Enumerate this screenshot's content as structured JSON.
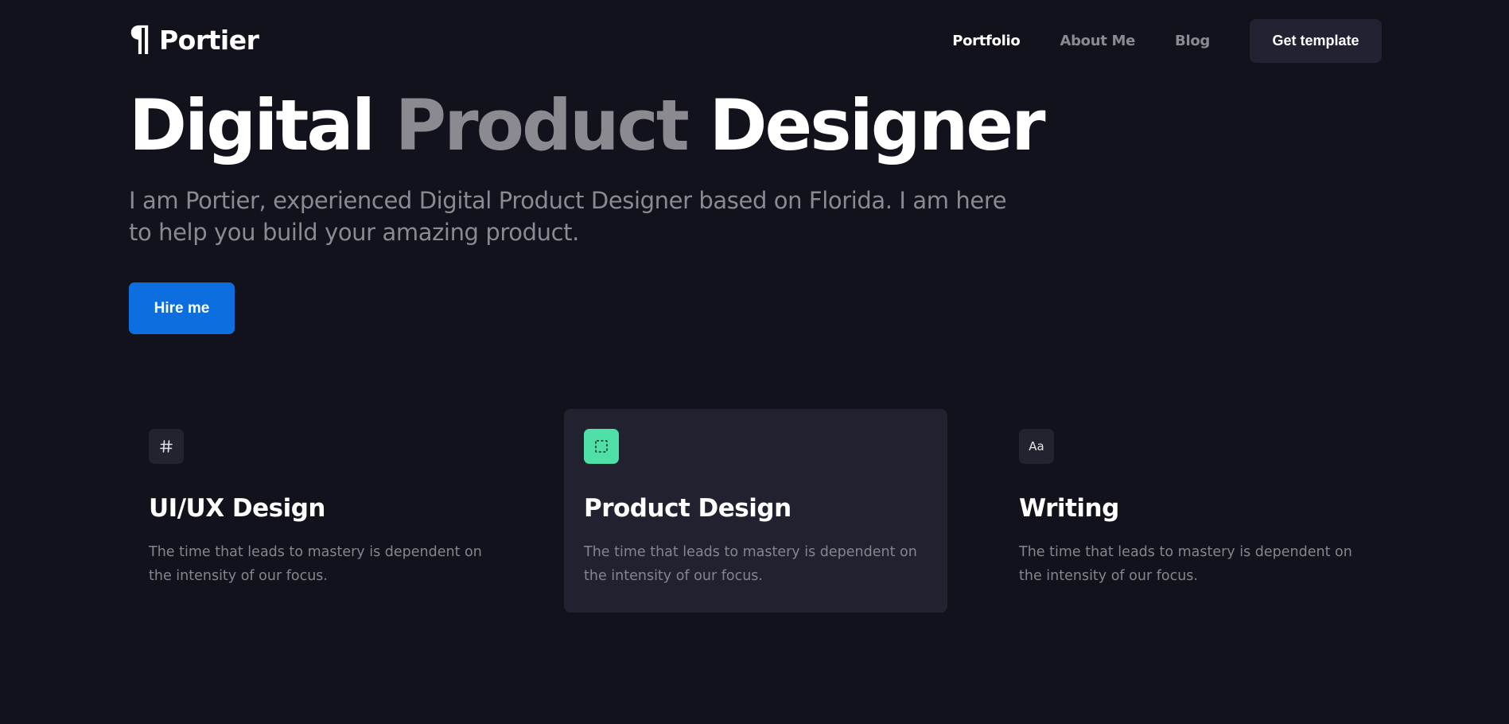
{
  "header": {
    "logo_mark": "¶",
    "logo_text": "Portier",
    "nav": [
      "Portfolio",
      "About Me",
      "Blog"
    ],
    "active_nav": "Portfolio",
    "cta_label": "Get template"
  },
  "hero": {
    "title_part1": "Digital",
    "title_part2": "Product",
    "title_part3": "Designer",
    "subtitle": "I am Portier, experienced Digital Product Designer based on Florida. I am here to help you build your amazing product.",
    "hire_label": "Hire me"
  },
  "services": [
    {
      "icon": "hash-icon",
      "icon_glyph": "#",
      "title": "UI/UX Design",
      "description": "The time that leads to mastery is dependent on the intensity of our focus."
    },
    {
      "icon": "selection-icon",
      "icon_glyph": "",
      "title": "Product Design",
      "description": "The time that leads to mastery is dependent on the intensity of our focus."
    },
    {
      "icon": "typography-icon",
      "icon_glyph": "Aa",
      "title": "Writing",
      "description": "The time that leads to mastery is dependent on the intensity of our focus."
    }
  ],
  "colors": {
    "background": "#12121c",
    "card_highlight": "#212130",
    "accent_blue": "#0d6ee0",
    "accent_green": "#4ee0a6",
    "muted_text": "#8a8a92"
  }
}
